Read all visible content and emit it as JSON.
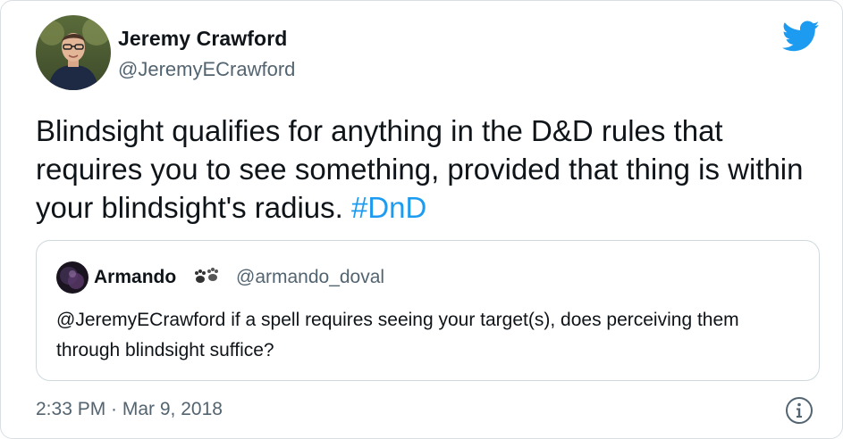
{
  "author": {
    "name": "Jeremy Crawford",
    "handle": "@JeremyECrawford"
  },
  "tweet": {
    "text_main": "Blindsight qualifies for anything in the D&D rules that requires you to see something, provided that thing is within your blindsight's radius. ",
    "hashtag": "#DnD",
    "timestamp": "2:33 PM · Mar 9, 2018"
  },
  "quoted_tweet": {
    "name": "Armando",
    "handle": "@armando_doval",
    "text": "@JeremyECrawford if a spell requires seeing your target(s), does perceiving them through blindsight suffice?"
  },
  "icons": {
    "brand": "twitter-bird-icon",
    "info": "info-icon"
  },
  "colors": {
    "brand": "#1d9bf0",
    "text": "#0f1419",
    "muted": "#536471",
    "border": "#cfd9de"
  }
}
